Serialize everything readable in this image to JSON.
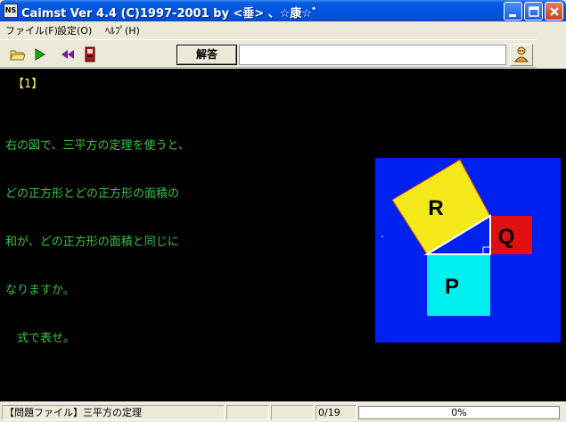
{
  "window": {
    "title": "Caimst Ver 4.4 (C)1997-2001  by <垂> 、☆康☆゛",
    "icon_text": "NS"
  },
  "menu": {
    "items": [
      {
        "label": "ファイル(F)"
      },
      {
        "label": "設定(O)"
      },
      {
        "label": "ﾍﾙﾌﾟ(H)"
      }
    ]
  },
  "toolbar": {
    "icons": [
      "open-folder-icon",
      "play-icon",
      "rewind-icon",
      "exit-door-icon"
    ],
    "answer_label": "解答",
    "answer_value": "",
    "hint_icon": "hint-person-icon"
  },
  "question": {
    "number": "【1】",
    "lines": [
      "右の図で、三平方の定理を使うと、",
      "どの正方形とどの正方形の面積の",
      "和が、どの正方形の面積と同じに",
      "なりますか。",
      "　式で表せ。"
    ]
  },
  "figure": {
    "labels": {
      "r": "R",
      "q": "Q",
      "p": "P"
    },
    "colors": {
      "background": "#0020f0",
      "r": "#f2e81a",
      "q": "#e01010",
      "p": "#00f0f0",
      "triangle": "#ffffff"
    }
  },
  "status": {
    "file": "【問題ファイル】三平方の定理",
    "counter": "0/19",
    "progress_percent": 0,
    "progress_text": "0%"
  }
}
